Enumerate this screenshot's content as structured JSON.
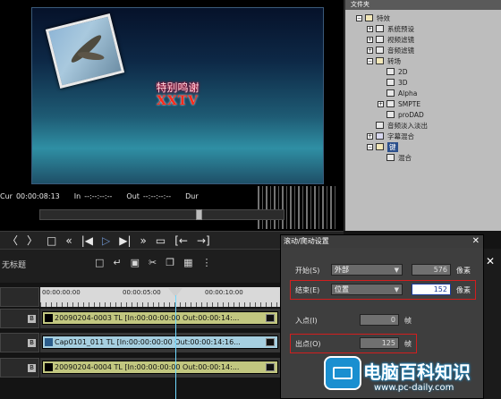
{
  "monitor": {
    "title_cn": "特别鸣谢",
    "title_xx": "XXTV",
    "timecode": {
      "cur_label": "Cur",
      "cur_value": "00:00:08:13",
      "in_label": "In",
      "in_value": "--:--:--:--",
      "out_label": "Out",
      "out_value": "--:--:--:--",
      "dur_label": "Dur"
    }
  },
  "transport": {
    "icons": [
      "mark-in-icon",
      "mark-out-icon",
      "stop-icon",
      "rewind-icon",
      "step-back-icon",
      "play-icon",
      "step-forward-icon",
      "fast-forward-icon",
      "output-icon",
      "goto-in-icon",
      "goto-out-icon"
    ]
  },
  "effects_panel": {
    "title": "文件夹",
    "items": [
      {
        "label": "特效",
        "icon": "folder-icon"
      },
      {
        "label": "系统预设",
        "icon": "preset-icon"
      },
      {
        "label": "视频滤镜",
        "icon": "filter-icon"
      },
      {
        "label": "音频滤镜",
        "icon": "filter-icon"
      },
      {
        "label": "转场",
        "icon": "folder-icon"
      },
      {
        "label": "2D",
        "icon": "transition-icon"
      },
      {
        "label": "3D",
        "icon": "transition-icon"
      },
      {
        "label": "Alpha",
        "icon": "transition-icon"
      },
      {
        "label": "SMPTE",
        "icon": "transition-icon"
      },
      {
        "label": "proDAD",
        "icon": "transition-icon"
      },
      {
        "label": "音频淡入淡出",
        "icon": "audio-icon"
      },
      {
        "label": "字幕混合",
        "icon": "title-icon"
      },
      {
        "label": "键",
        "icon": "key-icon"
      },
      {
        "label": "混合",
        "icon": "mix-icon"
      }
    ]
  },
  "toolbar": {
    "project_label": "无标题"
  },
  "timeline": {
    "ruler": [
      "00:00:00:00",
      "00:00:05:00",
      "00:00:10:00"
    ],
    "clips": [
      {
        "text": "20090204-0003  TL [In:00:00:00:00  Out:00:00:14:..."
      },
      {
        "text": "Cap0101_011  TL [In:00:00:00:00  Out:00:00:14:16..."
      },
      {
        "text": "20090204-0004  TL [In:00:00:00:00  Out:00:00:14:..."
      }
    ]
  },
  "dialog": {
    "title": "滚动/爬动设置",
    "start_label": "开始(S)",
    "start_value": "外部",
    "start_px": "576",
    "end_label": "结束(E)",
    "end_value": "位置",
    "end_px": "152",
    "px_unit": "像素",
    "in_label": "入点(I)",
    "in_value": "0",
    "out_label": "出点(O)",
    "out_value": "125",
    "frame_unit": "帧"
  },
  "watermark": {
    "cn": "电脑百科知识",
    "url": "www.pc-daily.com"
  }
}
